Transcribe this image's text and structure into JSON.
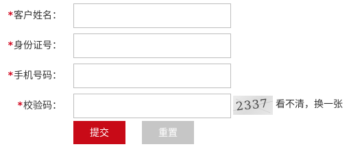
{
  "form": {
    "required_mark": "*",
    "fields": [
      {
        "label": "客户姓名：",
        "value": ""
      },
      {
        "label": "身份证号：",
        "value": ""
      },
      {
        "label": "手机号码：",
        "value": ""
      },
      {
        "label": "校验码：",
        "value": ""
      }
    ],
    "captcha": {
      "code": "2337",
      "refresh_label": "看不清，换一张"
    },
    "buttons": {
      "submit_label": "提交",
      "reset_label": "重置"
    }
  },
  "colors": {
    "required": "#d0021b",
    "submit_bg": "#c80a17",
    "reset_bg": "#c6c6c6",
    "input_border": "#bdbdbd"
  }
}
